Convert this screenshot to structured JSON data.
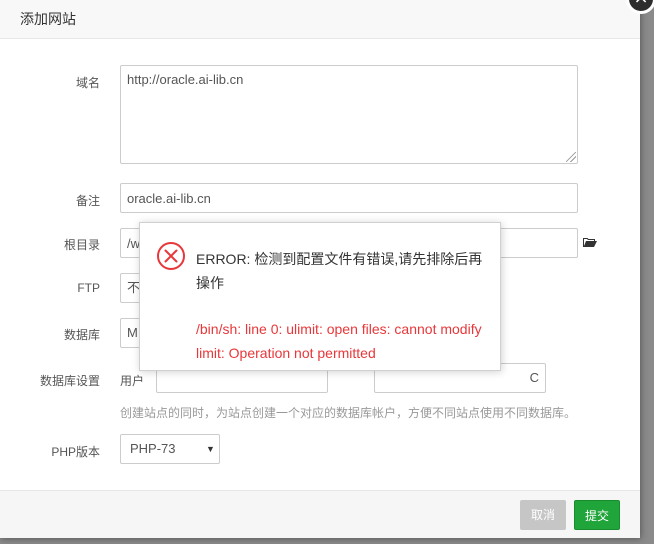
{
  "dialog": {
    "title": "添加网站",
    "close_icon": "close-icon"
  },
  "form": {
    "domain": {
      "label": "域名",
      "value": "http://oracle.ai-lib.cn"
    },
    "remark": {
      "label": "备注",
      "value": "oracle.ai-lib.cn"
    },
    "root": {
      "label": "根目录",
      "value": "/w"
    },
    "ftp": {
      "label": "FTP",
      "value": "不"
    },
    "database": {
      "label": "数据库",
      "value": "M"
    },
    "db_settings": {
      "label": "数据库设置",
      "user_prefix": "用户",
      "pass_suffix": "C"
    },
    "hint": "创建站点的同时，为站点创建一个对应的数据库帐户，方便不同站点使用不同数据库。",
    "php": {
      "label": "PHP版本",
      "value": "PHP-73",
      "arrow": "▼"
    }
  },
  "footer": {
    "cancel_label": "取消",
    "submit_label": "提交"
  },
  "error": {
    "title": "ERROR: 检测到配置文件有错误,请先排除后再操作",
    "detail": "/bin/sh: line 0: ulimit: open files: cannot modify limit: Operation not permitted",
    "color": "#e8373a"
  },
  "colors": {
    "submit": "#20a53a",
    "cancel": "#c6c6c6"
  }
}
